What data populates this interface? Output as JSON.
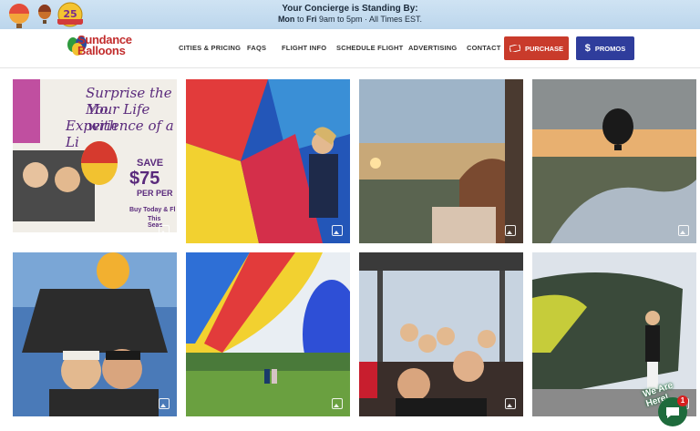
{
  "topbar": {
    "concierge_line1": "Your Concierge is Standing By:",
    "days_start": "Mon",
    "days_to": "to",
    "days_end": "Fri",
    "hours": "9am to 5pm · All Times EST.",
    "anniversary_badge_text": "25 ANNIVERSARY"
  },
  "brand": {
    "logo_line1": "Sundance",
    "logo_line2": "Balloons"
  },
  "nav": {
    "items": [
      "CITIES & PRICING",
      "FAQS",
      "FLIGHT INFO",
      "SCHEDULE FLIGHT",
      "ADVERTISING",
      "CONTACT"
    ],
    "purchase_label": "PURCHASE",
    "promos_label": "PROMOS",
    "promos_icon": "$"
  },
  "promo_tile": {
    "line1": "Surprise the Mo",
    "line2": "Your Life with",
    "line3": "Experience of a Li",
    "save": "SAVE",
    "price": "$75",
    "per": "PER PER",
    "buy": "Buy Today & Fl",
    "season": "This Seas"
  },
  "gallery": {
    "tiles": [
      {
        "name": "promo-graphic"
      },
      {
        "name": "woman-with-balloon-envelope"
      },
      {
        "name": "sunrise-from-basket"
      },
      {
        "name": "balloon-over-lake"
      },
      {
        "name": "couple-selfie-in-basket"
      },
      {
        "name": "balloons-inflating-field"
      },
      {
        "name": "group-in-basket"
      },
      {
        "name": "woman-beside-deflated-balloon"
      }
    ]
  },
  "chat": {
    "label": "We Are Here!",
    "count": "1"
  },
  "colors": {
    "purchase": "#c93b2b",
    "promos": "#2f3d9c",
    "chat": "#1e6b3c"
  }
}
